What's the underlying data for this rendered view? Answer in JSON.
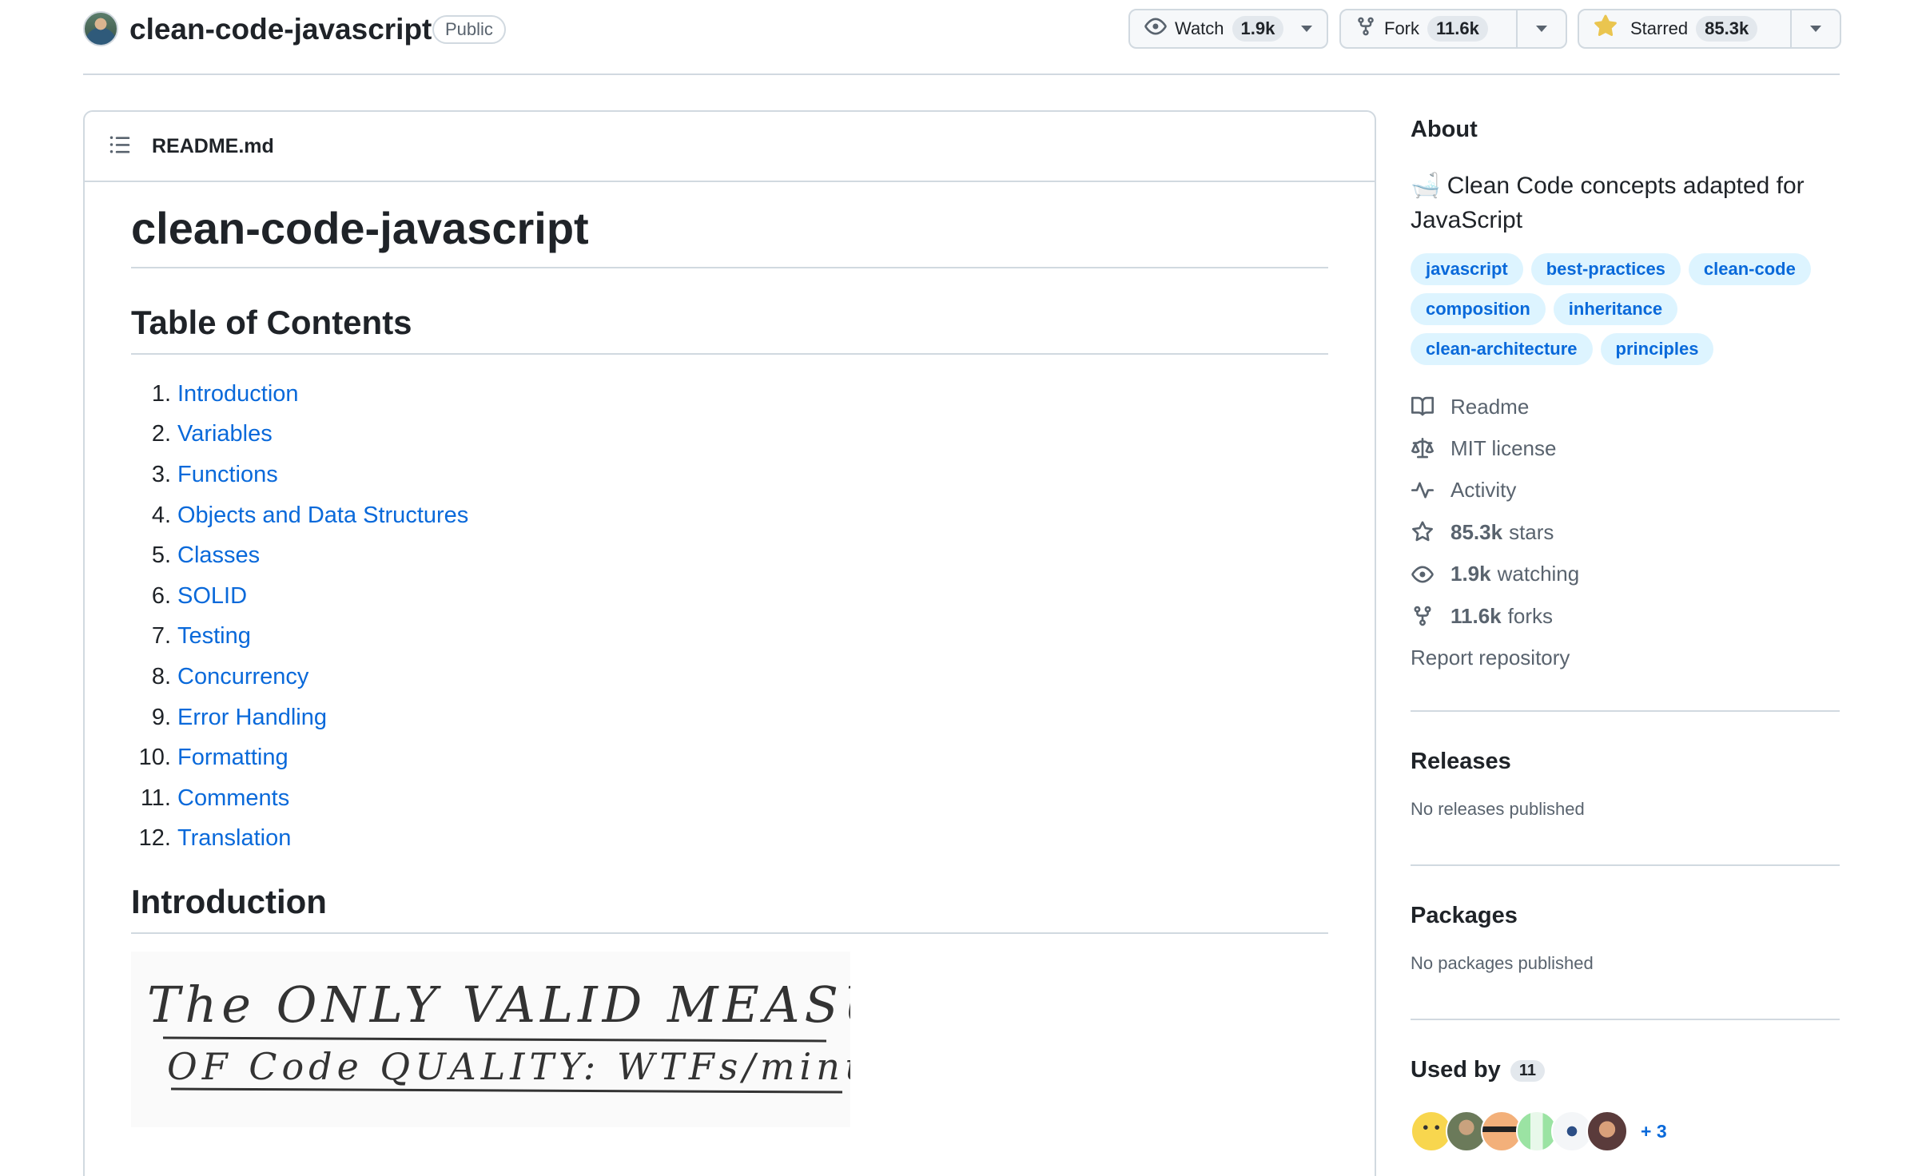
{
  "repo": {
    "name": "clean-code-javascript",
    "visibility": "Public"
  },
  "actions": {
    "watch": {
      "label": "Watch",
      "count": "1.9k"
    },
    "fork": {
      "label": "Fork",
      "count": "11.6k"
    },
    "star": {
      "label": "Starred",
      "count": "85.3k"
    }
  },
  "readme": {
    "file_name": "README.md",
    "title": "clean-code-javascript",
    "toc_heading": "Table of Contents",
    "toc": [
      {
        "num": "1.",
        "label": "Introduction"
      },
      {
        "num": "2.",
        "label": "Variables"
      },
      {
        "num": "3.",
        "label": "Functions"
      },
      {
        "num": "4.",
        "label": "Objects and Data Structures"
      },
      {
        "num": "5.",
        "label": "Classes"
      },
      {
        "num": "6.",
        "label": "SOLID"
      },
      {
        "num": "7.",
        "label": "Testing"
      },
      {
        "num": "8.",
        "label": "Concurrency"
      },
      {
        "num": "9.",
        "label": "Error Handling"
      },
      {
        "num": "10.",
        "label": "Formatting"
      },
      {
        "num": "11.",
        "label": "Comments"
      },
      {
        "num": "12.",
        "label": "Translation"
      }
    ],
    "intro_heading": "Introduction",
    "image_text_line1": "The ONLY VALID MEASUREMENT",
    "image_text_line2": "OF Code QUALITY: WTFs/minute"
  },
  "about": {
    "heading": "About",
    "emoji": "🛁",
    "description": "Clean Code concepts adapted for JavaScript",
    "topics": [
      "javascript",
      "best-practices",
      "clean-code",
      "composition",
      "inheritance",
      "clean-architecture",
      "principles"
    ],
    "readme_label": "Readme",
    "license_label": "MIT license",
    "activity_label": "Activity",
    "stars_count": "85.3k",
    "stars_label": "stars",
    "watching_count": "1.9k",
    "watching_label": "watching",
    "forks_count": "11.6k",
    "forks_label": "forks",
    "report_label": "Report repository"
  },
  "releases": {
    "heading": "Releases",
    "text": "No releases published"
  },
  "packages": {
    "heading": "Packages",
    "text": "No packages published"
  },
  "used_by": {
    "heading": "Used by",
    "count": "11",
    "more": "+ 3"
  },
  "colors": {
    "accent": "#0969da",
    "topic_bg": "#ddf4ff",
    "border": "#d1d9e0",
    "star": "#eac54f"
  }
}
